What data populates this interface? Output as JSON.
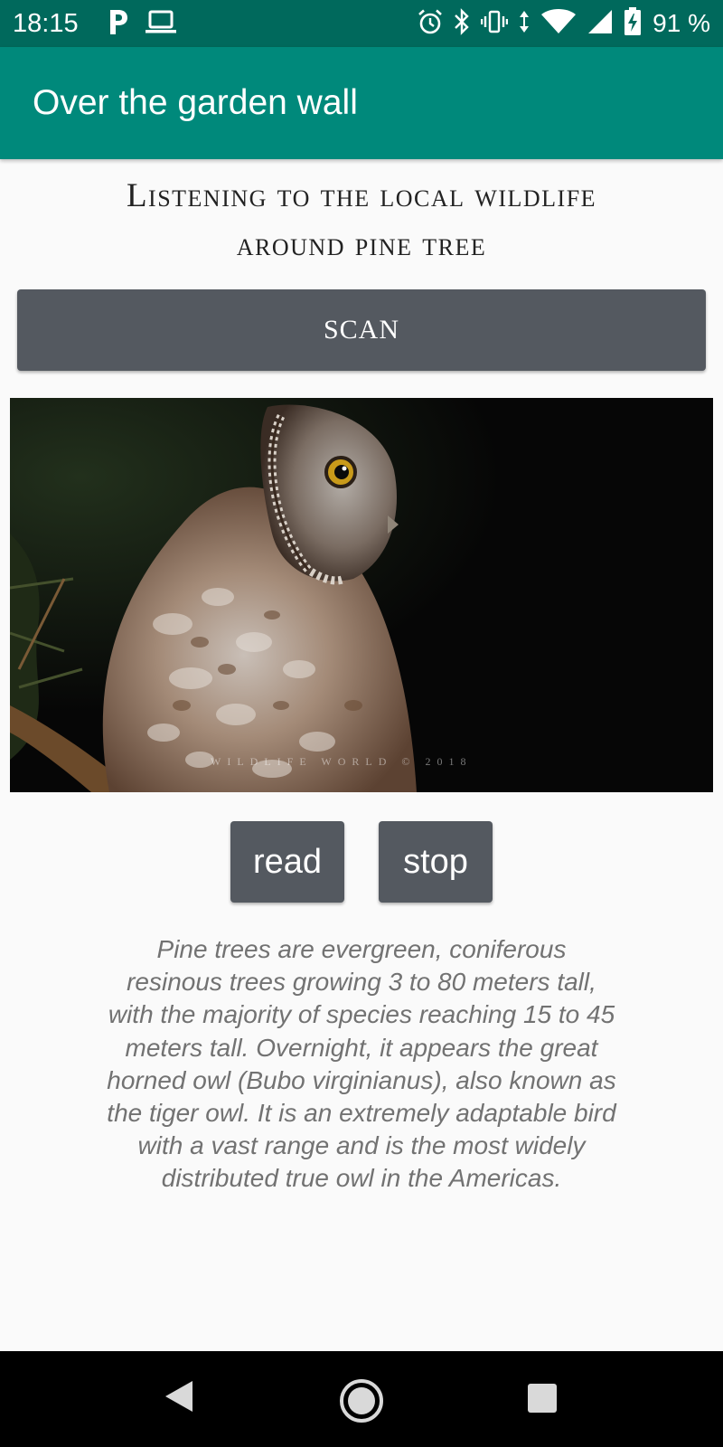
{
  "status_bar": {
    "time": "18:15",
    "battery_percent": "91 %",
    "left_icons": [
      "parking-p-icon",
      "laptop-icon"
    ],
    "right_icons": [
      "alarm-icon",
      "bluetooth-icon",
      "vibrate-icon",
      "data-arrows-icon",
      "wifi-icon",
      "signal-icon",
      "battery-charging-icon"
    ]
  },
  "app_bar": {
    "title": "Over the garden wall"
  },
  "main": {
    "heading_line1": "Listening to the local wildlife",
    "heading_line2": "around pine tree",
    "scan_label": "SCAN",
    "image_watermark": "WILDLIFE WORLD © 2018",
    "read_label": "read",
    "stop_label": "stop",
    "description": "Pine trees are evergreen, coniferous resinous trees growing 3 to 80 meters tall, with the majority of species reaching 15 to 45 meters tall. Overnight, it appears the great horned owl (Bubo virginianus), also known as the tiger owl. It is an extremely adaptable bird with a vast range and is the most widely distributed true owl in the Americas."
  },
  "nav_bar": {
    "icons": [
      "back-icon",
      "home-icon",
      "recents-icon"
    ]
  },
  "colors": {
    "status_bar": "#00695c",
    "app_bar": "#00897b",
    "button": "#545960",
    "background": "#fafafa",
    "description_text": "#727272"
  }
}
